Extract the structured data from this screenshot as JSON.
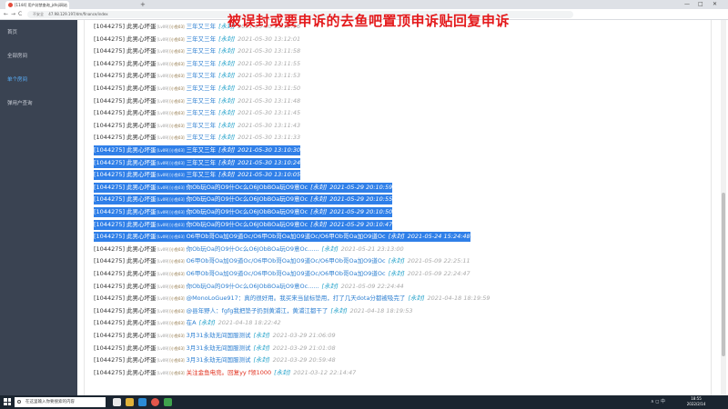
{
  "browser": {
    "tab_active_title": "[1144] 用户封禁查询_jsfeji网站",
    "tab_inactive_title": "",
    "new_tab": "+",
    "address_insecure": "不安全",
    "address_url": "47.98.129.197/dm/finance/index",
    "back": "←",
    "forward": "→",
    "reload": "C",
    "minimize": "—",
    "maximize": "□",
    "close": "✕"
  },
  "headline": "被误封或要申诉的去鱼吧置顶申诉贴回复申诉",
  "sidebar": {
    "items": [
      {
        "label": "首页",
        "active": false
      },
      {
        "label": "全部房间",
        "active": false
      },
      {
        "label": "单个房间",
        "active": true
      },
      {
        "label": "弹用户查询",
        "active": false
      }
    ]
  },
  "rows": [
    {
      "id": "[1044275]",
      "user": "此男心坏蛋",
      "lvl": "[Lv09]",
      "tag": "[小鱼03]",
      "msg": "三年又三年",
      "ban": "[永封]",
      "time": "2021-05-30 13:12:16",
      "hl": false
    },
    {
      "id": "[1044275]",
      "user": "此男心坏蛋",
      "lvl": "[Lv09]",
      "tag": "[小鱼03]",
      "msg": "三年又三年",
      "ban": "[永封]",
      "time": "2021-05-30 13:12:01",
      "hl": false
    },
    {
      "id": "[1044275]",
      "user": "此男心坏蛋",
      "lvl": "[Lv09]",
      "tag": "[小鱼03]",
      "msg": "三年又三年",
      "ban": "[永封]",
      "time": "2021-05-30 13:11:58",
      "hl": false
    },
    {
      "id": "[1044275]",
      "user": "此男心坏蛋",
      "lvl": "[Lv09]",
      "tag": "[小鱼03]",
      "msg": "三年又三年",
      "ban": "[永封]",
      "time": "2021-05-30 13:11:55",
      "hl": false
    },
    {
      "id": "[1044275]",
      "user": "此男心坏蛋",
      "lvl": "[Lv09]",
      "tag": "[小鱼03]",
      "msg": "三年又三年",
      "ban": "[永封]",
      "time": "2021-05-30 13:11:53",
      "hl": false
    },
    {
      "id": "[1044275]",
      "user": "此男心坏蛋",
      "lvl": "[Lv09]",
      "tag": "[小鱼03]",
      "msg": "三年又三年",
      "ban": "[永封]",
      "time": "2021-05-30 13:11:50",
      "hl": false
    },
    {
      "id": "[1044275]",
      "user": "此男心坏蛋",
      "lvl": "[Lv09]",
      "tag": "[小鱼03]",
      "msg": "三年又三年",
      "ban": "[永封]",
      "time": "2021-05-30 13:11:48",
      "hl": false
    },
    {
      "id": "[1044275]",
      "user": "此男心坏蛋",
      "lvl": "[Lv09]",
      "tag": "[小鱼03]",
      "msg": "三年又三年",
      "ban": "[永封]",
      "time": "2021-05-30 13:11:45",
      "hl": false
    },
    {
      "id": "[1044275]",
      "user": "此男心坏蛋",
      "lvl": "[Lv09]",
      "tag": "[小鱼03]",
      "msg": "三年又三年",
      "ban": "[永封]",
      "time": "2021-05-30 13:11:43",
      "hl": false
    },
    {
      "id": "[1044275]",
      "user": "此男心坏蛋",
      "lvl": "[Lv09]",
      "tag": "[小鱼03]",
      "msg": "三年又三年",
      "ban": "[永封]",
      "time": "2021-05-30 13:11:33",
      "hl": false
    },
    {
      "id": "[1044275]",
      "user": "此男心坏蛋",
      "lvl": "[Lv09]",
      "tag": "[小鱼03]",
      "msg": "三年又三年",
      "ban": "[永封]",
      "time": "2021-05-30 13:10:30",
      "hl": true
    },
    {
      "id": "[1044275]",
      "user": "此男心坏蛋",
      "lvl": "[Lv09]",
      "tag": "[小鱼03]",
      "msg": "三年又三年",
      "ban": "[永封]",
      "time": "2021-05-30 13:10:24",
      "hl": true
    },
    {
      "id": "[1044275]",
      "user": "此男心坏蛋",
      "lvl": "[Lv09]",
      "tag": "[小鱼03]",
      "msg": "三年又三年",
      "ban": "[永封]",
      "time": "2021-05-30 13:10:05",
      "hl": true
    },
    {
      "id": "[1044275]",
      "user": "此男心坏蛋",
      "lvl": "[Lv09]",
      "tag": "[小鱼03]",
      "msg": "你Ob玩Oa的O9什Oc么O6JObBOa玩O9意Oc",
      "ban": "[永封]",
      "time": "2021-05-29 20:10:59",
      "hl": true
    },
    {
      "id": "[1044275]",
      "user": "此男心坏蛋",
      "lvl": "[Lv09]",
      "tag": "[小鱼03]",
      "msg": "你Ob玩Oa的O9什Oc么O6JObBOa玩O9意Oc",
      "ban": "[永封]",
      "time": "2021-05-29 20:10:55",
      "hl": true
    },
    {
      "id": "[1044275]",
      "user": "此男心坏蛋",
      "lvl": "[Lv09]",
      "tag": "[小鱼03]",
      "msg": "你Ob玩Oa的O9什Oc么O6JObBOa玩O9意Oc",
      "ban": "[永封]",
      "time": "2021-05-29 20:10:50",
      "hl": true
    },
    {
      "id": "[1044275]",
      "user": "此男心坏蛋",
      "lvl": "[Lv09]",
      "tag": "[小鱼03]",
      "msg": "你Ob玩Oa的O9什Oc么O6JObBOa玩O9意Oc",
      "ban": "[永封]",
      "time": "2021-05-29 20:10:47",
      "hl": true
    },
    {
      "id": "[1044275]",
      "user": "此男心坏蛋",
      "lvl": "[Lv09]",
      "tag": "[小鱼03]",
      "msg": "O6甲Ob哥Oa加O9道Oc/O6甲Ob哥Oa加O9道Oc/O6甲Ob哥Oa加O9道Oc",
      "ban": "[永封]",
      "time": "2021-05-24 15:24:48",
      "hl": true
    },
    {
      "id": "[1044275]",
      "user": "此男心坏蛋",
      "lvl": "[Lv09]",
      "tag": "[小鱼03]",
      "msg": "你Ob玩Oa的O9什Oc么O6JObBOa玩O9意Oc......",
      "ban": "[永封]",
      "time": "2021-05-21 23:13:00",
      "hl": false
    },
    {
      "id": "[1044275]",
      "user": "此男心坏蛋",
      "lvl": "[Lv09]",
      "tag": "[小鱼03]",
      "msg": "O6甲Ob哥Oa加O9道Oc/O6甲Ob哥Oa加O9道Oc/O6甲Ob哥Oa加O9道Oc",
      "ban": "[永封]",
      "time": "2021-05-09 22:25:11",
      "hl": false
    },
    {
      "id": "[1044275]",
      "user": "此男心坏蛋",
      "lvl": "[Lv09]",
      "tag": "[小鱼03]",
      "msg": "O6甲Ob哥Oa加O9道Oc/O6甲Ob哥Oa加O9道Oc/O6甲Ob哥Oa加O9道Oc",
      "ban": "[永封]",
      "time": "2021-05-09 22:24:47",
      "hl": false
    },
    {
      "id": "[1044275]",
      "user": "此男心坏蛋",
      "lvl": "[Lv09]",
      "tag": "[小鱼03]",
      "msg": "你Ob玩Oa的O9什Oc么O6JObBOa玩O9意Oc......",
      "ban": "[永封]",
      "time": "2021-05-09 22:24:44",
      "hl": false
    },
    {
      "id": "[1044275]",
      "user": "此男心坏蛋",
      "lvl": "[Lv09]",
      "tag": "[小鱼03]",
      "msg": "@MonoLoGue917：真的很好用。我买来当鼠标垫用，打了几天dota分都被吸完了",
      "ban": "[永封]",
      "time": "2021-04-18 18:19:59",
      "hl": false
    },
    {
      "id": "[1044275]",
      "user": "此男心坏蛋",
      "lvl": "[Lv09]",
      "tag": "[小鱼03]",
      "msg": "@县年野人：fgfg我把垫子扔到黄浦江，黄浦江都干了",
      "ban": "[永封]",
      "time": "2021-04-18 18:19:53",
      "hl": false
    },
    {
      "id": "[1044275]",
      "user": "此男心坏蛋",
      "lvl": "[Lv09]",
      "tag": "[小鱼03]",
      "msg": "在A",
      "ban": "[永封]",
      "time": "2021-04-18 18:22:42",
      "hl": false
    },
    {
      "id": "[1044275]",
      "user": "此男心坏蛋",
      "lvl": "[Lv09]",
      "tag": "[小鱼03]",
      "msg": "3月31永劫无间国服测试",
      "ban": "[永封]",
      "time": "2021-03-29 21:06:09",
      "hl": false
    },
    {
      "id": "[1044275]",
      "user": "此男心坏蛋",
      "lvl": "[Lv09]",
      "tag": "[小鱼03]",
      "msg": "3月31永劫无间国服测试",
      "ban": "[永封]",
      "time": "2021-03-29 21:01:08",
      "hl": false
    },
    {
      "id": "[1044275]",
      "user": "此男心坏蛋",
      "lvl": "[Lv09]",
      "tag": "[小鱼03]",
      "msg": "3月31永劫无间国服测试",
      "ban": "[永封]",
      "time": "2021-03-29 20:59:48",
      "hl": false
    },
    {
      "id": "[1044275]",
      "user": "此男心坏蛋",
      "lvl": "[Lv09]",
      "tag": "[小鱼03]",
      "msg": "关注金鱼电竞。回复yy f领1000",
      "ban": "[永封]",
      "time": "2021-03-12 22:14:47",
      "hl": false,
      "red": true
    }
  ],
  "taskbar": {
    "search_placeholder": "在这里输入你要搜索的内容",
    "time": "18:55",
    "date": "2022/2/14",
    "tray": "∧ ◻ 中"
  },
  "colors": {
    "sidebar_bg": "#3a4352",
    "highlight": "#2f7fe8",
    "headline": "#e4191b"
  }
}
